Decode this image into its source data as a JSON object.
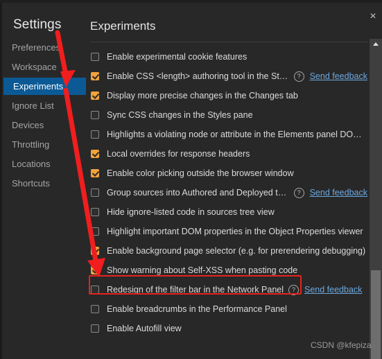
{
  "window": {
    "close_label": "×"
  },
  "sidebar": {
    "title": "Settings",
    "items": [
      {
        "label": "Preferences",
        "selected": false
      },
      {
        "label": "Workspace",
        "selected": false
      },
      {
        "label": "Experiments",
        "selected": true
      },
      {
        "label": "Ignore List",
        "selected": false
      },
      {
        "label": "Devices",
        "selected": false
      },
      {
        "label": "Throttling",
        "selected": false
      },
      {
        "label": "Locations",
        "selected": false
      },
      {
        "label": "Shortcuts",
        "selected": false
      }
    ],
    "selected_color": "#0b5a96"
  },
  "content": {
    "title": "Experiments",
    "feedback_label": "Send feedback",
    "help_glyph": "?",
    "experiments": [
      {
        "label": "Enable experimental cookie features",
        "checked": false,
        "help": false,
        "feedback": false
      },
      {
        "label": "Enable CSS <length> authoring tool in the Styles ...",
        "checked": true,
        "help": true,
        "feedback": true
      },
      {
        "label": "Display more precise changes in the Changes tab",
        "checked": true,
        "help": false,
        "feedback": false
      },
      {
        "label": "Sync CSS changes in the Styles pane",
        "checked": false,
        "help": false,
        "feedback": false
      },
      {
        "label": "Highlights a violating node or attribute in the Elements panel DOM t...",
        "checked": false,
        "help": false,
        "feedback": false
      },
      {
        "label": "Local overrides for response headers",
        "checked": true,
        "help": false,
        "feedback": false
      },
      {
        "label": "Enable color picking outside the browser window",
        "checked": true,
        "help": false,
        "feedback": false
      },
      {
        "label": "Group sources into Authored and Deployed trees",
        "checked": false,
        "help": true,
        "feedback": true
      },
      {
        "label": "Hide ignore-listed code in sources tree view",
        "checked": false,
        "help": false,
        "feedback": false
      },
      {
        "label": "Highlight important DOM properties in the Object Properties viewer",
        "checked": false,
        "help": false,
        "feedback": false
      },
      {
        "label": "Enable background page selector (e.g. for prerendering debugging)",
        "checked": true,
        "help": false,
        "feedback": false
      },
      {
        "label": "Show warning about Self-XSS when pasting code",
        "checked": true,
        "help": false,
        "feedback": false
      },
      {
        "label": "Redesign of the filter bar in the Network Panel",
        "checked": false,
        "help": true,
        "feedback": true
      },
      {
        "label": "Enable breadcrumbs in the Performance Panel",
        "checked": false,
        "help": false,
        "feedback": false
      },
      {
        "label": "Enable Autofill view",
        "checked": false,
        "help": false,
        "feedback": false
      }
    ]
  },
  "annotations": {
    "highlight_color": "#e8221f",
    "arrow_color": "#f01e1e",
    "highlighted_row_label": "Show warning about Self-XSS when pasting code"
  },
  "watermark": {
    "text": "CSDN @kfepiza"
  },
  "colors": {
    "background": "#282828",
    "checkbox_checked": "#f2a33c",
    "link": "#6ca8e0",
    "scrollbar_track": "#3f3f3f",
    "scrollbar_thumb": "#6e6e6e"
  }
}
